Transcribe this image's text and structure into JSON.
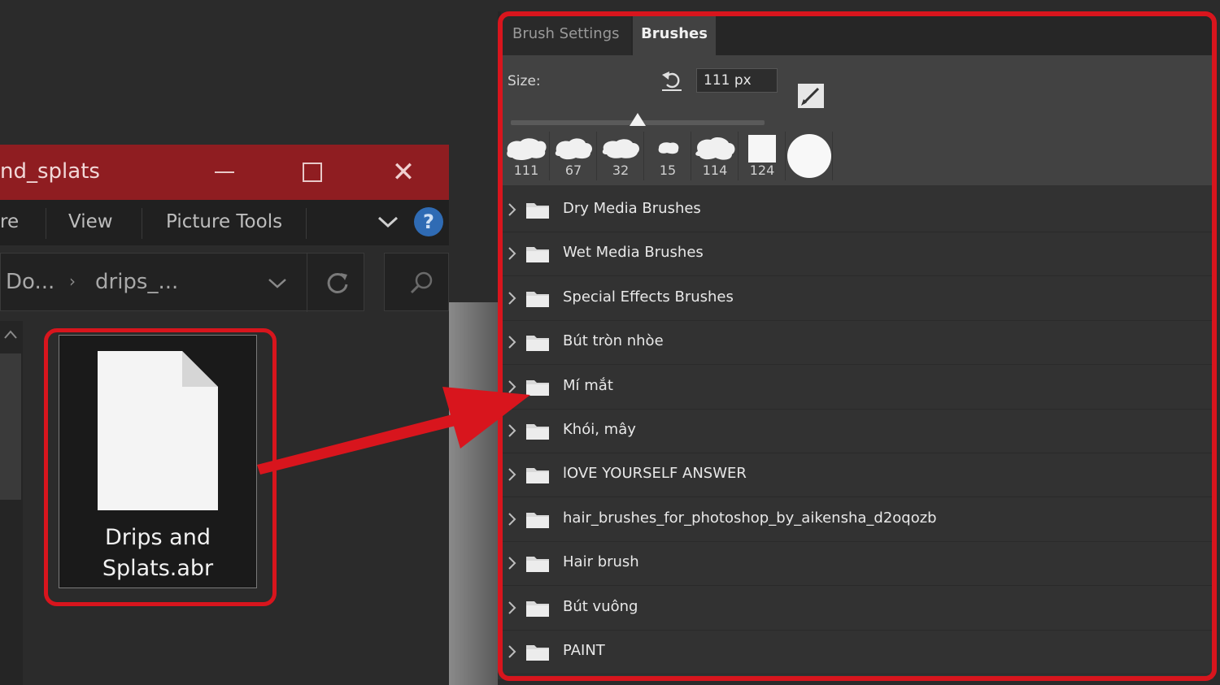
{
  "explorer": {
    "title": "nd_splats",
    "ribbon": {
      "share_label": "re",
      "view_label": "View",
      "picture_tools_label": "Picture Tools"
    },
    "address": {
      "crumb1": "Do...",
      "crumb2": "drips_..."
    },
    "file": {
      "name_line1": "Drips and",
      "name_line2": "Splats.abr"
    }
  },
  "brushes_panel": {
    "tabs": [
      "Brush Settings",
      "Brushes"
    ],
    "active_tab": "Brushes",
    "size_label": "Size:",
    "size_value": "111 px",
    "slider_fraction": 0.5,
    "presets": [
      {
        "size": "111",
        "shape": "splatter-icon"
      },
      {
        "size": "67",
        "shape": "splatter-icon"
      },
      {
        "size": "32",
        "shape": "splatter-icon"
      },
      {
        "size": "15",
        "shape": "splatter-icon"
      },
      {
        "size": "114",
        "shape": "splatter-icon"
      },
      {
        "size": "124",
        "shape": "square-brush-icon"
      },
      {
        "size": "",
        "shape": "round-brush-icon"
      }
    ],
    "folders": [
      "Dry Media Brushes",
      "Wet Media Brushes",
      "Special Effects Brushes",
      "Bút tròn nhòe",
      "Mí mắt",
      "Khói, mây",
      "lOVE YOURSELF ANSWER",
      "hair_brushes_for_photoshop_by_aikensha_d2oqozb",
      "Hair brush",
      "Bút vuông",
      "PAINT"
    ]
  },
  "colors": {
    "highlight": "#d8151d",
    "title_bar": "#8f1d21",
    "help_blue": "#2f6bb4"
  }
}
